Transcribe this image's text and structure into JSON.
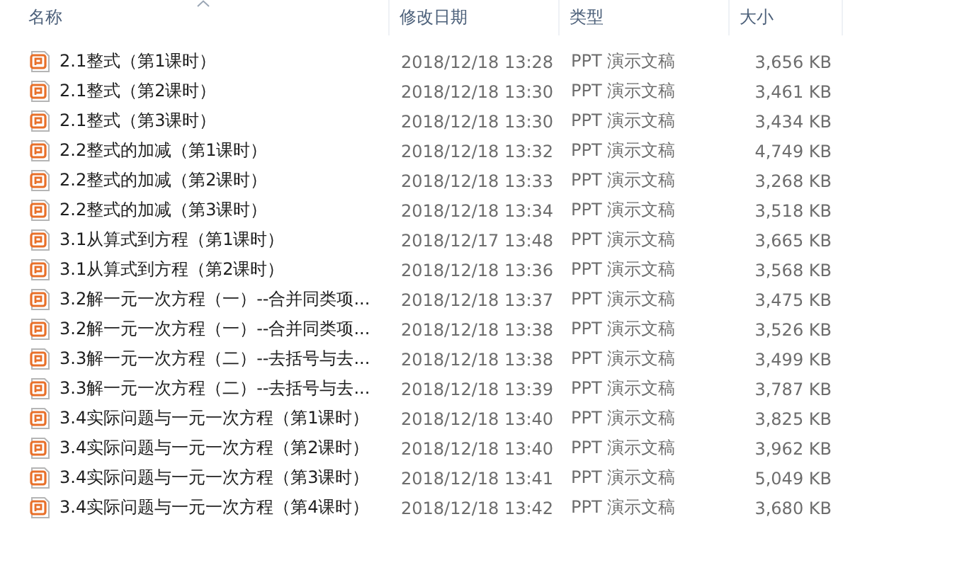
{
  "columns": [
    {
      "label": "名称",
      "sorted": true
    },
    {
      "label": "修改日期",
      "sorted": false
    },
    {
      "label": "类型",
      "sorted": false
    },
    {
      "label": "大小",
      "sorted": false
    }
  ],
  "files": [
    {
      "name": "2.1整式（第1课时）",
      "modified": "2018/12/18 13:28",
      "type": "PPT 演示文稿",
      "size": "3,656 KB"
    },
    {
      "name": "2.1整式（第2课时）",
      "modified": "2018/12/18 13:30",
      "type": "PPT 演示文稿",
      "size": "3,461 KB"
    },
    {
      "name": "2.1整式（第3课时）",
      "modified": "2018/12/18 13:30",
      "type": "PPT 演示文稿",
      "size": "3,434 KB"
    },
    {
      "name": "2.2整式的加减（第1课时）",
      "modified": "2018/12/18 13:32",
      "type": "PPT 演示文稿",
      "size": "4,749 KB"
    },
    {
      "name": "2.2整式的加减（第2课时）",
      "modified": "2018/12/18 13:33",
      "type": "PPT 演示文稿",
      "size": "3,268 KB"
    },
    {
      "name": "2.2整式的加减（第3课时）",
      "modified": "2018/12/18 13:34",
      "type": "PPT 演示文稿",
      "size": "3,518 KB"
    },
    {
      "name": "3.1从算式到方程（第1课时）",
      "modified": "2018/12/17 13:48",
      "type": "PPT 演示文稿",
      "size": "3,665 KB"
    },
    {
      "name": "3.1从算式到方程（第2课时）",
      "modified": "2018/12/18 13:36",
      "type": "PPT 演示文稿",
      "size": "3,568 KB"
    },
    {
      "name": "3.2解一元一次方程（一）--合并同类项...",
      "modified": "2018/12/18 13:37",
      "type": "PPT 演示文稿",
      "size": "3,475 KB"
    },
    {
      "name": "3.2解一元一次方程（一）--合并同类项...",
      "modified": "2018/12/18 13:38",
      "type": "PPT 演示文稿",
      "size": "3,526 KB"
    },
    {
      "name": "3.3解一元一次方程（二）--去括号与去...",
      "modified": "2018/12/18 13:38",
      "type": "PPT 演示文稿",
      "size": "3,499 KB"
    },
    {
      "name": "3.3解一元一次方程（二）--去括号与去...",
      "modified": "2018/12/18 13:39",
      "type": "PPT 演示文稿",
      "size": "3,787 KB"
    },
    {
      "name": "3.4实际问题与一元一次方程（第1课时）",
      "modified": "2018/12/18 13:40",
      "type": "PPT 演示文稿",
      "size": "3,825 KB"
    },
    {
      "name": "3.4实际问题与一元一次方程（第2课时）",
      "modified": "2018/12/18 13:40",
      "type": "PPT 演示文稿",
      "size": "3,962 KB"
    },
    {
      "name": "3.4实际问题与一元一次方程（第3课时）",
      "modified": "2018/12/18 13:41",
      "type": "PPT 演示文稿",
      "size": "5,049 KB"
    },
    {
      "name": "3.4实际问题与一元一次方程（第4课时）",
      "modified": "2018/12/18 13:42",
      "type": "PPT 演示文稿",
      "size": "3,680 KB"
    }
  ]
}
